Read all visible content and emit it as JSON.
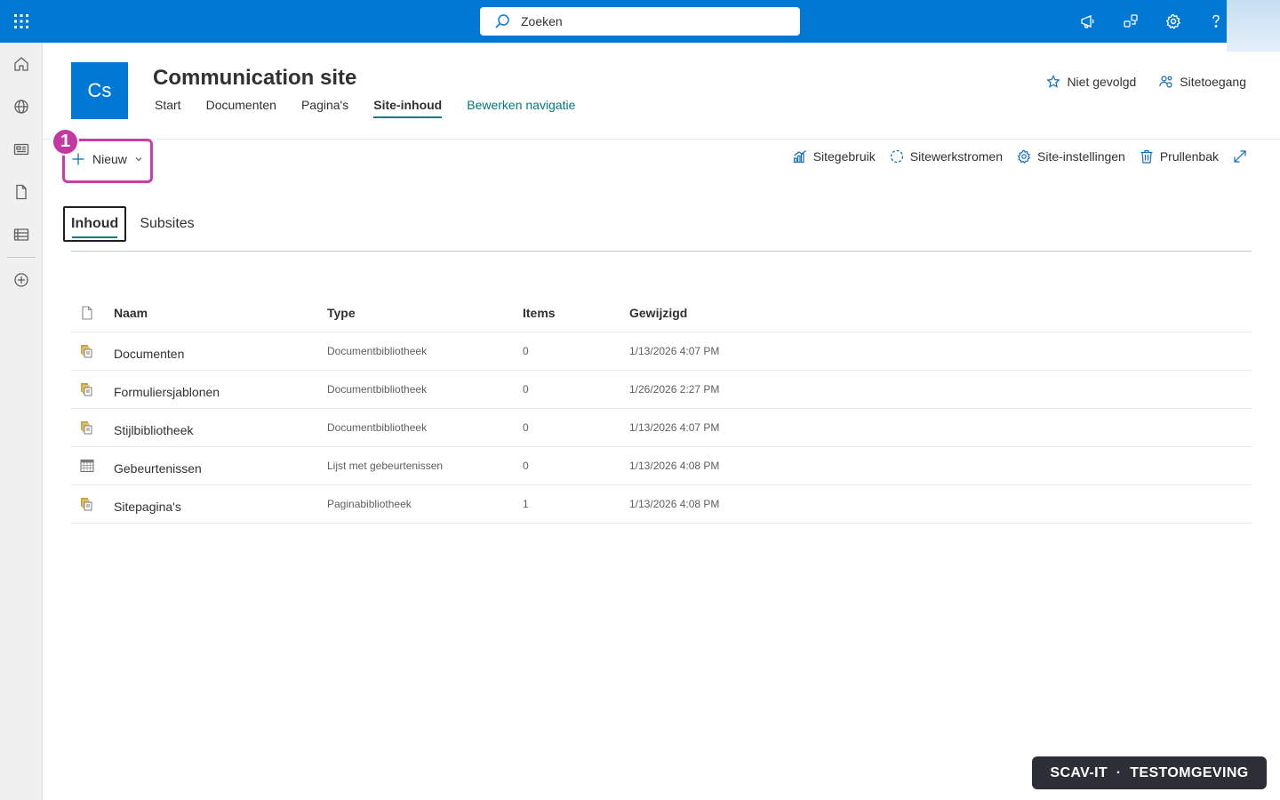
{
  "suitebar": {
    "search_placeholder": "Zoeken",
    "icons": [
      "megaphone-icon",
      "share-icon",
      "gear-icon",
      "help-icon"
    ]
  },
  "appbar": {
    "items": [
      "home-icon",
      "globe-icon",
      "news-icon",
      "document-icon",
      "list-icon",
      "add-circle-icon"
    ]
  },
  "site": {
    "logo_text": "Cs",
    "title": "Communication site",
    "nav": [
      {
        "label": "Start"
      },
      {
        "label": "Documenten"
      },
      {
        "label": "Pagina's"
      },
      {
        "label": "Site-inhoud"
      },
      {
        "label": "Bewerken navigatie"
      }
    ],
    "follow_label": "Niet gevolgd",
    "access_label": "Sitetoegang"
  },
  "commandbar": {
    "new_label": "Nieuw",
    "step_number": "1",
    "usage_label": "Sitegebruik",
    "workflows_label": "Sitewerkstromen",
    "settings_label": "Site-instellingen",
    "recycle_label": "Prullenbak"
  },
  "tabs": [
    {
      "label": "Inhoud"
    },
    {
      "label": "Subsites"
    }
  ],
  "table": {
    "headers": {
      "name": "Naam",
      "type": "Type",
      "items": "Items",
      "modified": "Gewijzigd"
    },
    "rows": [
      {
        "name": "Documenten",
        "type": "Documentbibliotheek",
        "items": "0",
        "modified": "1/13/2026 4:07 PM",
        "icon": "library-icon"
      },
      {
        "name": "Formuliersjablonen",
        "type": "Documentbibliotheek",
        "items": "0",
        "modified": "1/26/2026 2:27 PM",
        "icon": "library-icon"
      },
      {
        "name": "Stijlbibliotheek",
        "type": "Documentbibliotheek",
        "items": "0",
        "modified": "1/13/2026 4:07 PM",
        "icon": "library-icon"
      },
      {
        "name": "Gebeurtenissen",
        "type": "Lijst met gebeurtenissen",
        "items": "0",
        "modified": "1/13/2026 4:08 PM",
        "icon": "calendar-list-icon"
      },
      {
        "name": "Sitepagina's",
        "type": "Paginabibliotheek",
        "items": "1",
        "modified": "1/13/2026 4:08 PM",
        "icon": "library-icon"
      }
    ]
  },
  "env_badge": "SCAV-IT  ·  TESTOMGEVING",
  "colors": {
    "brand": "#0078d4",
    "accent_teal": "#03787c",
    "highlight": "#cc3da8"
  }
}
